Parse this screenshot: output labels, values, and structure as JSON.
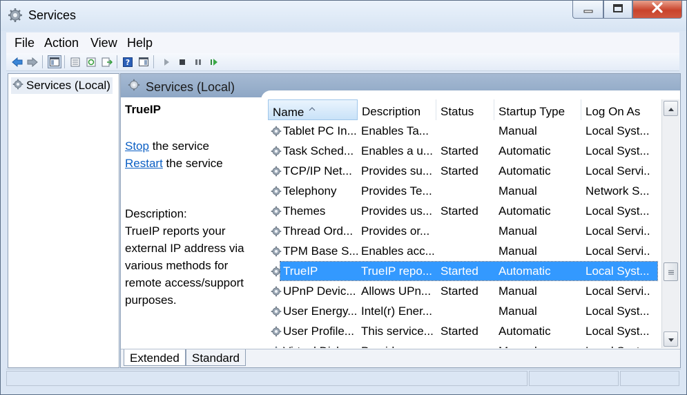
{
  "window": {
    "title": "Services",
    "minimize_icon": "minimize-icon",
    "maximize_icon": "maximize-icon",
    "close_icon": "close-icon"
  },
  "menu": [
    "File",
    "Action",
    "View",
    "Help"
  ],
  "toolbar": [
    "back-arrow-icon",
    "forward-arrow-icon",
    "show-hide-console-tree-icon",
    "properties-icon",
    "refresh-icon",
    "export-list-icon",
    "help-icon",
    "show-hide-action-pane-icon",
    "start-service-icon",
    "stop-service-icon",
    "pause-service-icon",
    "restart-service-icon"
  ],
  "tree": {
    "item_label": "Services (Local)"
  },
  "pane": {
    "title": "Services (Local)"
  },
  "detail": {
    "service_name": "TrueIP",
    "stop_link": "Stop",
    "stop_rest": " the service",
    "restart_link": "Restart",
    "restart_rest": " the service",
    "description_label": "Description:",
    "description_text": "TrueIP reports your external IP address via various methods for remote access/support purposes."
  },
  "columns": [
    "Name",
    "Description",
    "Status",
    "Startup Type",
    "Log On As"
  ],
  "rows": [
    {
      "name": "Tablet PC In...",
      "description": "Enables Ta...",
      "status": "",
      "startup": "Manual",
      "logon": "Local Syst..."
    },
    {
      "name": "Task Sched...",
      "description": "Enables a u...",
      "status": "Started",
      "startup": "Automatic",
      "logon": "Local Syst..."
    },
    {
      "name": "TCP/IP Net...",
      "description": "Provides su...",
      "status": "Started",
      "startup": "Automatic",
      "logon": "Local Servi..."
    },
    {
      "name": "Telephony",
      "description": "Provides Te...",
      "status": "",
      "startup": "Manual",
      "logon": "Network S..."
    },
    {
      "name": "Themes",
      "description": "Provides us...",
      "status": "Started",
      "startup": "Automatic",
      "logon": "Local Syst..."
    },
    {
      "name": "Thread Ord...",
      "description": "Provides or...",
      "status": "",
      "startup": "Manual",
      "logon": "Local Servi..."
    },
    {
      "name": "TPM Base S...",
      "description": "Enables acc...",
      "status": "",
      "startup": "Manual",
      "logon": "Local Servi..."
    },
    {
      "name": "TrueIP",
      "description": "TrueIP repo...",
      "status": "Started",
      "startup": "Automatic",
      "logon": "Local Syst...",
      "selected": true
    },
    {
      "name": "UPnP Devic...",
      "description": "Allows UPn...",
      "status": "Started",
      "startup": "Manual",
      "logon": "Local Servi..."
    },
    {
      "name": "User Energy...",
      "description": "Intel(r) Ener...",
      "status": "",
      "startup": "Manual",
      "logon": "Local Syst..."
    },
    {
      "name": "User Profile...",
      "description": "This service...",
      "status": "Started",
      "startup": "Automatic",
      "logon": "Local Syst..."
    },
    {
      "name": "Virtual Disk",
      "description": "Provides m...",
      "status": "",
      "startup": "Manual",
      "logon": "Local Syst..."
    }
  ],
  "tabs": [
    "Extended",
    "Standard"
  ],
  "colors": {
    "selection": "#3399ff",
    "link": "#0b5fc4",
    "header": "#9fb5cf"
  }
}
